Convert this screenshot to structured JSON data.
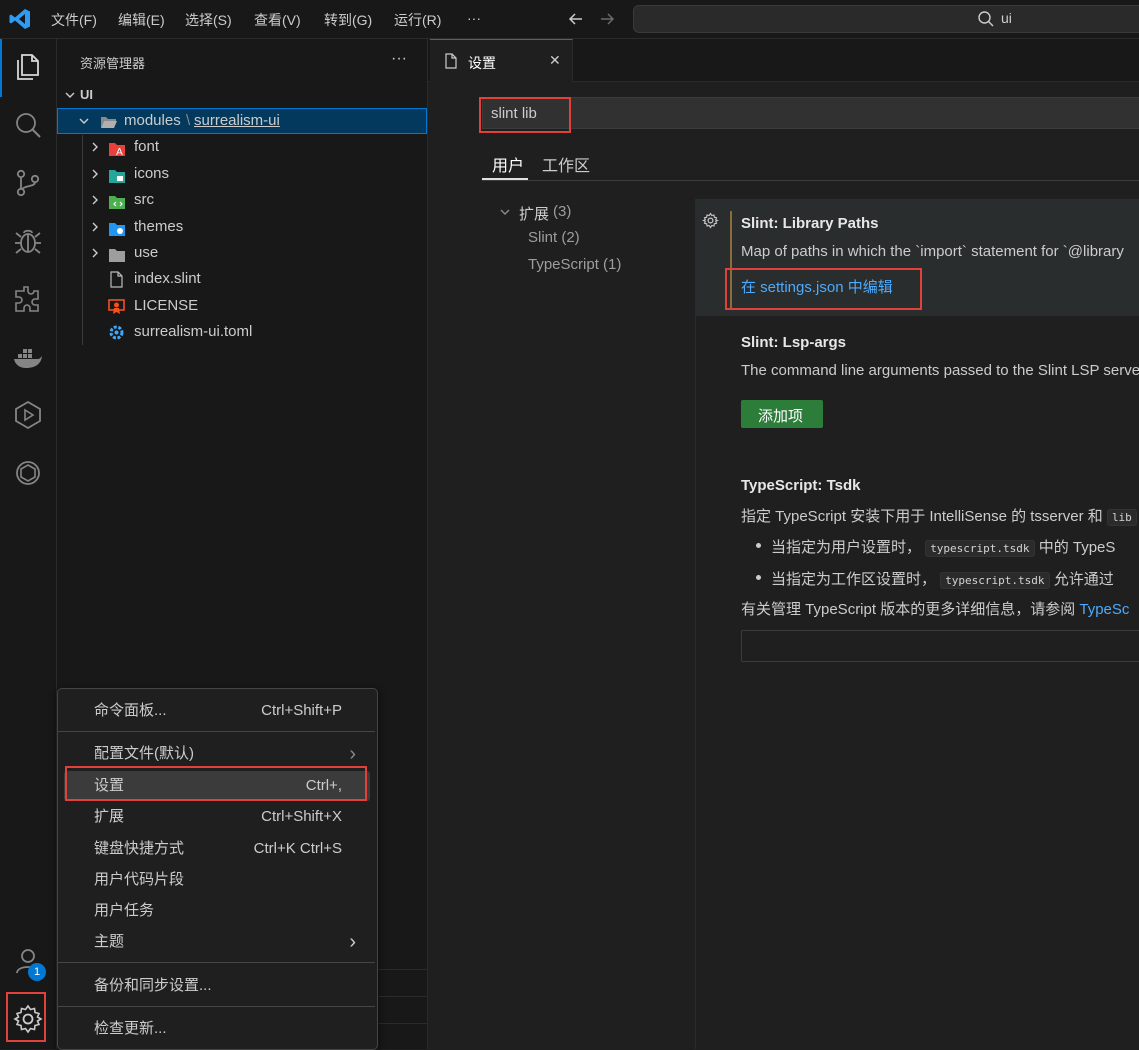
{
  "titlebar": {
    "menus": [
      "文件(F)",
      "编辑(E)",
      "选择(S)",
      "查看(V)",
      "转到(G)",
      "运行(R)",
      "···"
    ],
    "search_text": "ui"
  },
  "explorer": {
    "title": "资源管理器",
    "more": "···",
    "root": "UI",
    "folder_prefix": "modules",
    "folder_sep": "\\",
    "folder_link": "surrealism-ui",
    "items": [
      {
        "label": "font",
        "icon": "font-folder-icon"
      },
      {
        "label": "icons",
        "icon": "icons-folder-icon"
      },
      {
        "label": "src",
        "icon": "src-folder-icon"
      },
      {
        "label": "themes",
        "icon": "themes-folder-icon"
      },
      {
        "label": "use",
        "icon": "folder-icon"
      },
      {
        "label": "index.slint",
        "icon": "file-icon"
      },
      {
        "label": "LICENSE",
        "icon": "license-icon"
      },
      {
        "label": "surrealism-ui.toml",
        "icon": "gear-file-icon"
      }
    ]
  },
  "editor": {
    "tab_label": "设置",
    "close": "✕",
    "search_value": "slint lib",
    "scope_tabs": [
      "用户",
      "工作区"
    ],
    "toc": {
      "ext_label": "扩展",
      "ext_count": "(3)",
      "items": [
        "Slint (2)",
        "TypeScript (1)"
      ]
    },
    "settings": [
      {
        "title": "Slint: Library Paths",
        "desc": "Map of paths in which the `import` statement for `@library",
        "link": "在 settings.json 中编辑"
      },
      {
        "title": "Slint: Lsp-args",
        "desc": "The command line arguments passed to the Slint LSP serve",
        "button": "添加项"
      },
      {
        "title": "TypeScript: Tsdk",
        "desc_prefix": "指定 TypeScript 安装下用于 IntelliSense 的 tsserver 和",
        "desc_chip": "lib",
        "bullets": [
          {
            "prefix": "当指定为用户设置时，",
            "chip": "typescript.tsdk",
            "suffix": "中的 TypeS"
          },
          {
            "prefix": "当指定为工作区设置时，",
            "chip": "typescript.tsdk",
            "suffix": "允许通过"
          }
        ],
        "more_prefix": "有关管理 TypeScript 版本的更多详细信息，请参阅",
        "more_link": "TypeSc"
      }
    ]
  },
  "context_menu": {
    "items": [
      {
        "label": "命令面板...",
        "shortcut": "Ctrl+Shift+P"
      },
      {
        "label": "配置文件(默认)",
        "submenu": "›"
      },
      {
        "label": "设置",
        "shortcut": "Ctrl+,"
      },
      {
        "label": "扩展",
        "shortcut": "Ctrl+Shift+X"
      },
      {
        "label": "键盘快捷方式",
        "shortcut": "Ctrl+K Ctrl+S"
      },
      {
        "label": "用户代码片段"
      },
      {
        "label": "用户任务"
      },
      {
        "label": "主题",
        "submenu": "›"
      },
      {
        "label": "备份和同步设置..."
      },
      {
        "label": "检查更新..."
      }
    ]
  },
  "activity": {
    "account_badge": "1"
  },
  "colors": {
    "accent": "#0078d4",
    "highlight_red": "#e0413a",
    "button_green": "#2d7d3a",
    "link_blue": "#4daafc"
  }
}
